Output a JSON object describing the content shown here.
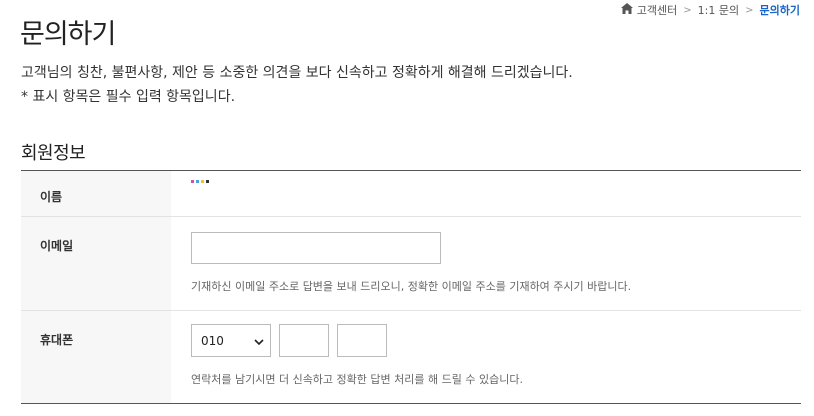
{
  "page": {
    "title": "문의하기"
  },
  "breadcrumb": {
    "home_label": "고객센터",
    "items": [
      "1:1 문의",
      "문의하기"
    ]
  },
  "intro": {
    "line1": "고객님의 칭찬, 불편사항, 제안 등 소중한 의견을 보다 신속하고 정확하게 해결해 드리겠습니다.",
    "line2": "* 표시 항목은 필수 입력 항목입니다."
  },
  "section": {
    "title": "회원정보"
  },
  "form": {
    "name_label": "이름",
    "email_label": "이메일",
    "email_value": "",
    "email_help": "기재하신 이메일 주소로 답변을 보내 드리오니, 정확한 이메일 주소를 기재하여 주시기 바랍니다.",
    "phone_label": "휴대폰",
    "phone_prefix": "010",
    "phone_middle": "",
    "phone_last": "",
    "phone_help": "연락처를 남기시면 더 신속하고 정확한 답변 처리를 해 드릴 수 있습니다."
  },
  "colors": {
    "accent": "#1a64c8",
    "masked_name_dots": [
      "#e34c9e",
      "#4aa3df",
      "#f2c12e",
      "#333333"
    ]
  }
}
